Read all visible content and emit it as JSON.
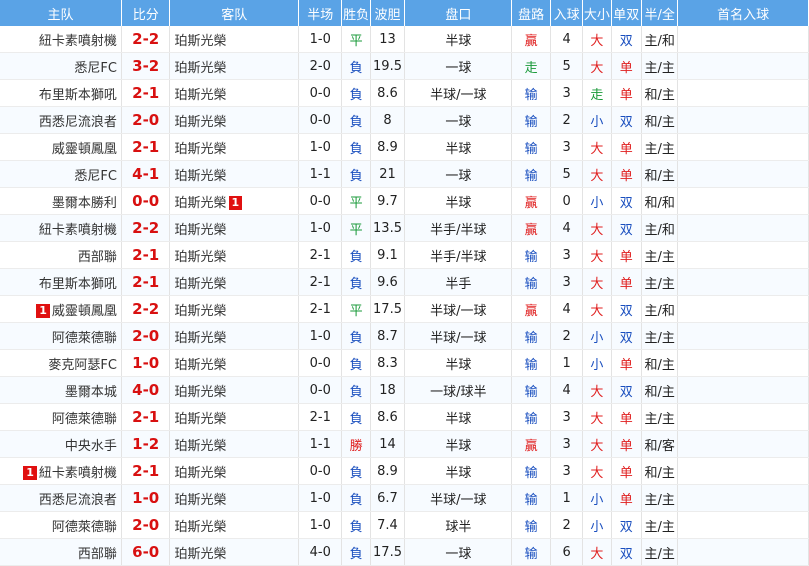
{
  "headers": [
    "主队",
    "比分",
    "客队",
    "半场",
    "胜负",
    "波胆",
    "盘口",
    "盘路",
    "入球",
    "大小",
    "单双",
    "半/全",
    "首名入球"
  ],
  "rows": [
    {
      "home_card": "",
      "home": "紐卡素噴射機",
      "score": "2-2",
      "away": "珀斯光榮",
      "away_card": "",
      "ht": "1-0",
      "wl": "平",
      "odds": "13",
      "handicap": "半球",
      "hr": "贏",
      "goals": "4",
      "ou": "大",
      "oe": "双",
      "htft": "主/和"
    },
    {
      "home_card": "",
      "home": "悉尼FC",
      "score": "3-2",
      "away": "珀斯光榮",
      "away_card": "",
      "ht": "2-0",
      "wl": "負",
      "odds": "19.5",
      "handicap": "一球",
      "hr": "走",
      "goals": "5",
      "ou": "大",
      "oe": "单",
      "htft": "主/主"
    },
    {
      "home_card": "",
      "home": "布里斯本獅吼",
      "score": "2-1",
      "away": "珀斯光榮",
      "away_card": "",
      "ht": "0-0",
      "wl": "負",
      "odds": "8.6",
      "handicap": "半球/一球",
      "hr": "输",
      "goals": "3",
      "ou": "走",
      "oe": "单",
      "htft": "和/主"
    },
    {
      "home_card": "",
      "home": "西悉尼流浪者",
      "score": "2-0",
      "away": "珀斯光榮",
      "away_card": "",
      "ht": "0-0",
      "wl": "負",
      "odds": "8",
      "handicap": "一球",
      "hr": "输",
      "goals": "2",
      "ou": "小",
      "oe": "双",
      "htft": "和/主"
    },
    {
      "home_card": "",
      "home": "威靈頓鳳凰",
      "score": "2-1",
      "away": "珀斯光榮",
      "away_card": "",
      "ht": "1-0",
      "wl": "負",
      "odds": "8.9",
      "handicap": "半球",
      "hr": "输",
      "goals": "3",
      "ou": "大",
      "oe": "单",
      "htft": "主/主"
    },
    {
      "home_card": "",
      "home": "悉尼FC",
      "score": "4-1",
      "away": "珀斯光榮",
      "away_card": "",
      "ht": "1-1",
      "wl": "負",
      "odds": "21",
      "handicap": "一球",
      "hr": "输",
      "goals": "5",
      "ou": "大",
      "oe": "单",
      "htft": "和/主"
    },
    {
      "home_card": "",
      "home": "墨爾本勝利",
      "score": "0-0",
      "away": "珀斯光榮",
      "away_card": "1",
      "ht": "0-0",
      "wl": "平",
      "odds": "9.7",
      "handicap": "半球",
      "hr": "贏",
      "goals": "0",
      "ou": "小",
      "oe": "双",
      "htft": "和/和"
    },
    {
      "home_card": "",
      "home": "紐卡素噴射機",
      "score": "2-2",
      "away": "珀斯光榮",
      "away_card": "",
      "ht": "1-0",
      "wl": "平",
      "odds": "13.5",
      "handicap": "半手/半球",
      "hr": "贏",
      "goals": "4",
      "ou": "大",
      "oe": "双",
      "htft": "主/和"
    },
    {
      "home_card": "",
      "home": "西部聯",
      "score": "2-1",
      "away": "珀斯光榮",
      "away_card": "",
      "ht": "2-1",
      "wl": "負",
      "odds": "9.1",
      "handicap": "半手/半球",
      "hr": "输",
      "goals": "3",
      "ou": "大",
      "oe": "单",
      "htft": "主/主"
    },
    {
      "home_card": "",
      "home": "布里斯本獅吼",
      "score": "2-1",
      "away": "珀斯光榮",
      "away_card": "",
      "ht": "2-1",
      "wl": "負",
      "odds": "9.6",
      "handicap": "半手",
      "hr": "输",
      "goals": "3",
      "ou": "大",
      "oe": "单",
      "htft": "主/主"
    },
    {
      "home_card": "1",
      "home": "威靈頓鳳凰",
      "score": "2-2",
      "away": "珀斯光榮",
      "away_card": "",
      "ht": "2-1",
      "wl": "平",
      "odds": "17.5",
      "handicap": "半球/一球",
      "hr": "贏",
      "goals": "4",
      "ou": "大",
      "oe": "双",
      "htft": "主/和"
    },
    {
      "home_card": "",
      "home": "阿德萊德聯",
      "score": "2-0",
      "away": "珀斯光榮",
      "away_card": "",
      "ht": "1-0",
      "wl": "負",
      "odds": "8.7",
      "handicap": "半球/一球",
      "hr": "输",
      "goals": "2",
      "ou": "小",
      "oe": "双",
      "htft": "主/主"
    },
    {
      "home_card": "",
      "home": "麥克阿瑟FC",
      "score": "1-0",
      "away": "珀斯光榮",
      "away_card": "",
      "ht": "0-0",
      "wl": "負",
      "odds": "8.3",
      "handicap": "半球",
      "hr": "输",
      "goals": "1",
      "ou": "小",
      "oe": "单",
      "htft": "和/主"
    },
    {
      "home_card": "",
      "home": "墨爾本城",
      "score": "4-0",
      "away": "珀斯光榮",
      "away_card": "",
      "ht": "0-0",
      "wl": "負",
      "odds": "18",
      "handicap": "一球/球半",
      "hr": "输",
      "goals": "4",
      "ou": "大",
      "oe": "双",
      "htft": "和/主"
    },
    {
      "home_card": "",
      "home": "阿德萊德聯",
      "score": "2-1",
      "away": "珀斯光榮",
      "away_card": "",
      "ht": "2-1",
      "wl": "負",
      "odds": "8.6",
      "handicap": "半球",
      "hr": "输",
      "goals": "3",
      "ou": "大",
      "oe": "单",
      "htft": "主/主"
    },
    {
      "home_card": "",
      "home": "中央水手",
      "score": "1-2",
      "away": "珀斯光榮",
      "away_card": "",
      "ht": "1-1",
      "wl": "勝",
      "odds": "14",
      "handicap": "半球",
      "hr": "贏",
      "goals": "3",
      "ou": "大",
      "oe": "单",
      "htft": "和/客"
    },
    {
      "home_card": "1",
      "home": "紐卡素噴射機",
      "score": "2-1",
      "away": "珀斯光榮",
      "away_card": "",
      "ht": "0-0",
      "wl": "負",
      "odds": "8.9",
      "handicap": "半球",
      "hr": "输",
      "goals": "3",
      "ou": "大",
      "oe": "单",
      "htft": "和/主"
    },
    {
      "home_card": "",
      "home": "西悉尼流浪者",
      "score": "1-0",
      "away": "珀斯光榮",
      "away_card": "",
      "ht": "1-0",
      "wl": "負",
      "odds": "6.7",
      "handicap": "半球/一球",
      "hr": "输",
      "goals": "1",
      "ou": "小",
      "oe": "单",
      "htft": "主/主"
    },
    {
      "home_card": "",
      "home": "阿德萊德聯",
      "score": "2-0",
      "away": "珀斯光榮",
      "away_card": "",
      "ht": "1-0",
      "wl": "負",
      "odds": "7.4",
      "handicap": "球半",
      "hr": "输",
      "goals": "2",
      "ou": "小",
      "oe": "双",
      "htft": "主/主"
    },
    {
      "home_card": "",
      "home": "西部聯",
      "score": "6-0",
      "away": "珀斯光榮",
      "away_card": "",
      "ht": "4-0",
      "wl": "負",
      "odds": "17.5",
      "handicap": "一球",
      "hr": "输",
      "goals": "6",
      "ou": "大",
      "oe": "双",
      "htft": "主/主"
    }
  ],
  "colors": {
    "header_bg": "#5aa3e6",
    "score": "#d81010",
    "win_draw_green": "#1a9a3a",
    "loss_blue": "#1a4fbf",
    "red_text": "#e02020",
    "card_bg": "#e01010"
  }
}
